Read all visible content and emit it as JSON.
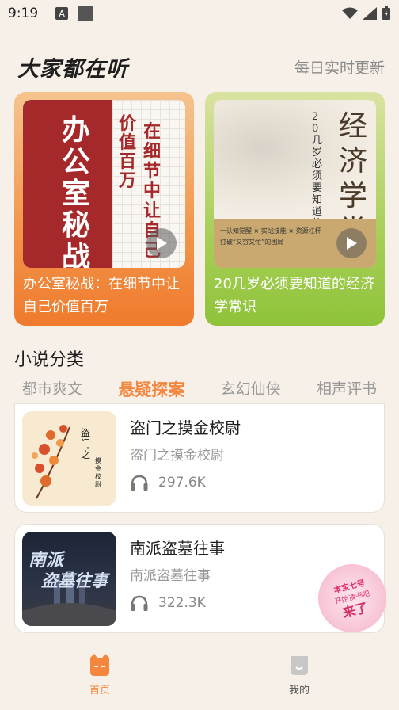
{
  "status_bar": {
    "time": "9:19",
    "a_icon": "A"
  },
  "header": {
    "title": "大家都在听",
    "subtitle": "每日实时更新"
  },
  "featured": [
    {
      "title": "办公室秘战：在细节中让自己价值百万",
      "cover_main": "办公室秘战",
      "cover_side": "在细节中让自己价值百万",
      "cover_side_line1": "价值百万",
      "cover_side_line2": "在细节中让自己"
    },
    {
      "title": "20几岁必须要知道的经济学常识",
      "cover_main": "经济学常识",
      "cover_side": "20几岁必须要知道的",
      "cover_tag1": "一认知觉醒 × 实战技能 × 资源杠杆",
      "cover_tag2": "打破“又穷又忙”的困局"
    }
  ],
  "section": {
    "title": "小说分类"
  },
  "tabs": [
    {
      "label": "都市爽文"
    },
    {
      "label": "悬疑探案"
    },
    {
      "label": "玄幻仙侠"
    },
    {
      "label": "相声评书"
    }
  ],
  "items": [
    {
      "title": "盗门之摸金校尉",
      "subtitle": "盗门之摸金校尉",
      "plays": "297.6K",
      "cover_text1": "盗门之",
      "cover_text2": "摸金校尉"
    },
    {
      "title": "南派盗墓往事",
      "subtitle": "南派盗墓往事",
      "plays": "322.3K",
      "cover_text1": "南派",
      "cover_text2": "盗墓往事"
    }
  ],
  "badge": {
    "line1": "本宝七号",
    "line2": "开始读书吧",
    "line3": "来了"
  },
  "nav": [
    {
      "label": "首页",
      "icon": "home-cat-icon"
    },
    {
      "label": "我的",
      "icon": "profile-icon"
    }
  ],
  "colors": {
    "accent": "#f4863d",
    "background": "#f7f0e8"
  }
}
